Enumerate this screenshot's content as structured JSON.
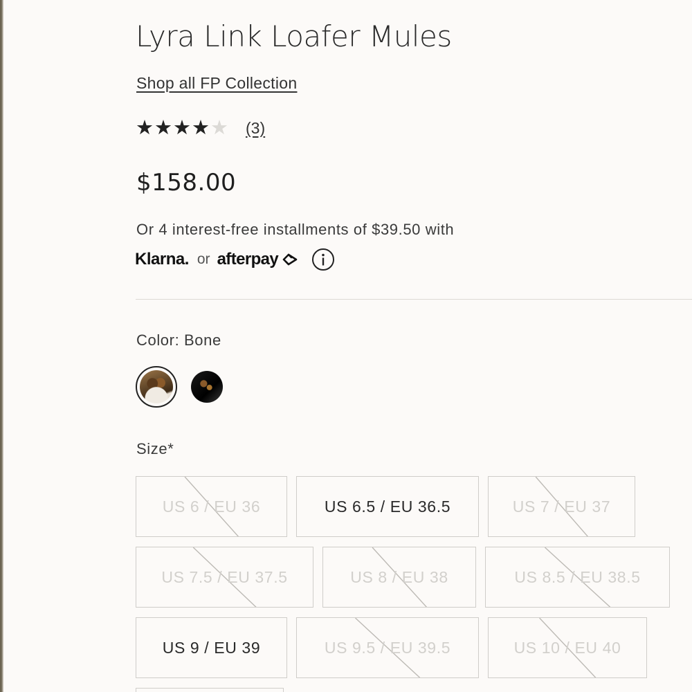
{
  "product": {
    "title": "Lyra Link Loafer Mules",
    "collection_link": "Shop all FP Collection",
    "rating": {
      "value": 4,
      "max": 5,
      "review_count": "(3)"
    },
    "price": "$158.00",
    "installments_text": "Or 4 interest-free installments of $39.50 with",
    "payment": {
      "klarna": "Klarna.",
      "or": "or",
      "afterpay": "afterpay"
    },
    "color_label": "Color: Bone",
    "swatches": [
      "Bone",
      "Black"
    ],
    "size_label": "Size*",
    "sizes": [
      {
        "label": "US 6 / EU 36",
        "available": false
      },
      {
        "label": "US 6.5 / EU 36.5",
        "available": true
      },
      {
        "label": "US 7 / EU 37",
        "available": false
      },
      {
        "label": "US 7.5 / EU 37.5",
        "available": false
      },
      {
        "label": "US 8 / EU 38",
        "available": false
      },
      {
        "label": "US 8.5 / EU 38.5",
        "available": false
      },
      {
        "label": "US 9 / EU 39",
        "available": true
      },
      {
        "label": "US 9.5 / EU 39.5",
        "available": false
      },
      {
        "label": "US 10 / EU 40",
        "available": false
      }
    ]
  },
  "colors": {
    "text": "#1e1e1e",
    "unavailable_text": "#d2d0cc",
    "border": "#cfcdc9",
    "background": "#fcfaf8"
  },
  "icons": {
    "rating": "star-icon",
    "info": "info-icon",
    "afterpay": "afterpay-arrows-icon"
  }
}
